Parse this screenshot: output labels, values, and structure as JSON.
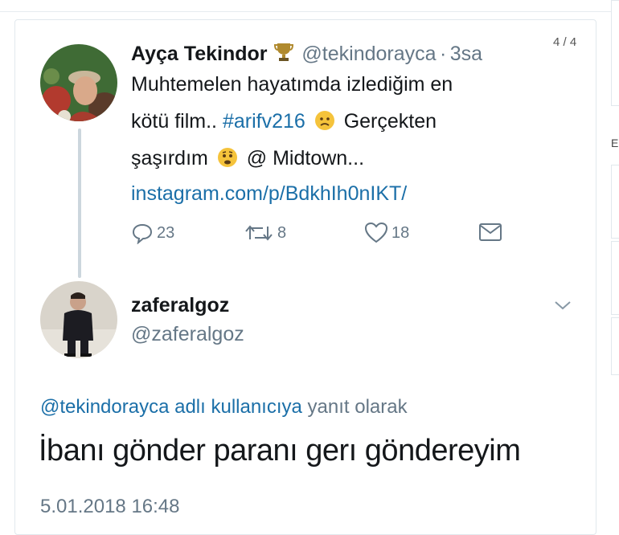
{
  "counter": "4 / 4",
  "rail_char": "E",
  "tweet": {
    "author_name": "Ayça Tekindor",
    "badge_icon": "trophy-icon",
    "handle": "@tekindorayca",
    "separator": "·",
    "time": "3sa",
    "line1": "Muhtemelen hayatımda izlediğim en",
    "line2_a": "kötü film..",
    "hashtag": "#arifv216",
    "line2_b": "Gerçekten",
    "line3_a": "şaşırdım",
    "line3_b": "@ Midtown...",
    "link": "instagram.com/p/BdkhIh0nIKT/",
    "replies": "23",
    "retweets": "8",
    "likes": "18"
  },
  "reply": {
    "author_name": "zaferalgoz",
    "handle": "@zaferalgoz",
    "reply_mention": "@tekindorayca adlı kullanıcıya",
    "reply_suffix": "yanıt olarak",
    "body": "İbanı gönder paranı gerı göndereyim",
    "timestamp": "5.01.2018 16:48"
  },
  "colors": {
    "link": "#1b6fa8",
    "muted": "#657786",
    "text": "#14171a",
    "thread_line": "#ccd6dd"
  }
}
